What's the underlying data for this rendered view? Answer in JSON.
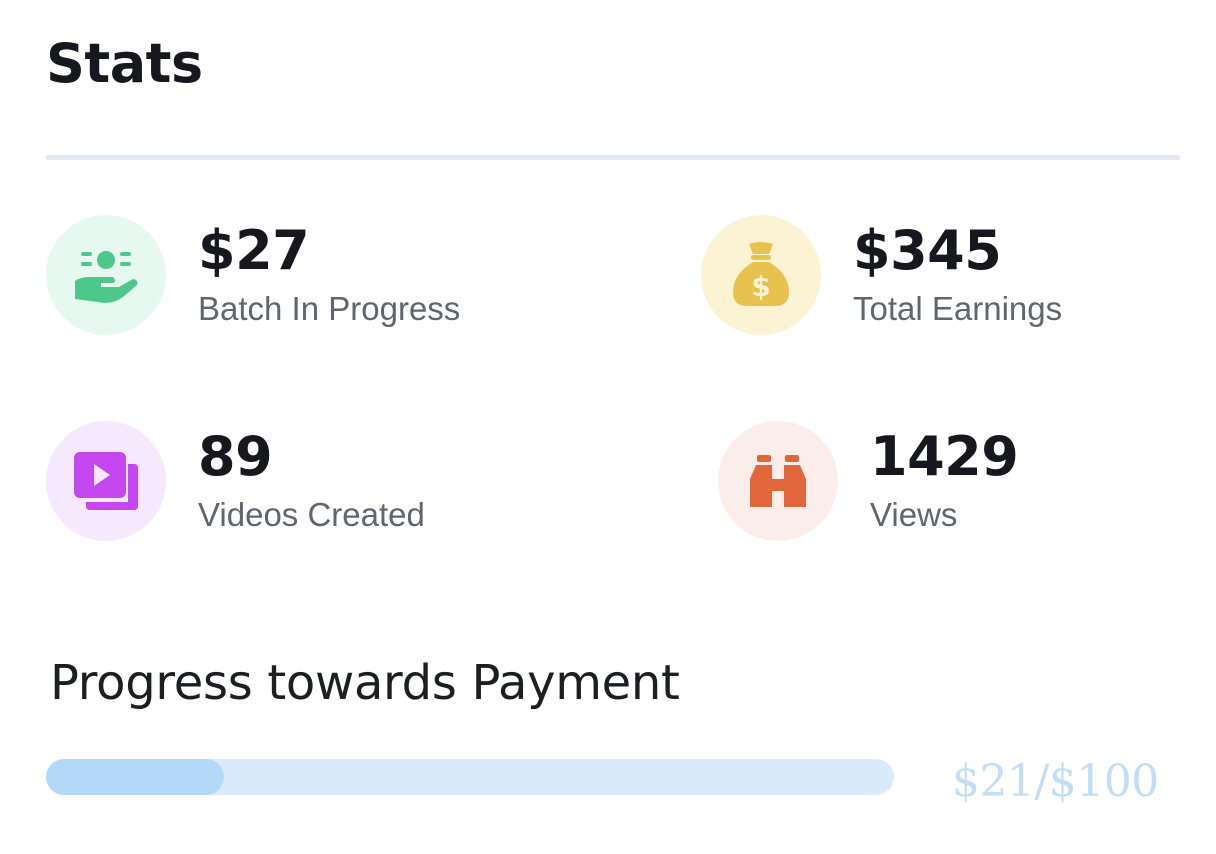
{
  "header": {
    "title": "Stats"
  },
  "stats": [
    {
      "value": "$27",
      "label": "Batch In Progress",
      "icon": "hand-cash-icon",
      "icon_bg": "#e6f8ef",
      "icon_color": "#4cc98a"
    },
    {
      "value": "$345",
      "label": "Total Earnings",
      "icon": "money-bag-icon",
      "icon_bg": "#fbf3d4",
      "icon_color": "#e7c24e"
    },
    {
      "value": "89",
      "label": "Videos Created",
      "icon": "video-library-icon",
      "icon_bg": "#f6e8fd",
      "icon_color": "#c447f0"
    },
    {
      "value": "1429",
      "label": "Views",
      "icon": "binoculars-icon",
      "icon_bg": "#fbeeea",
      "icon_color": "#e3673d"
    }
  ],
  "payment_progress": {
    "title": "Progress towards Payment",
    "amount_text": "$21/$100",
    "fraction": 0.21,
    "track_color": "#d9ebfb",
    "fill_color": "#b4d8f7"
  }
}
